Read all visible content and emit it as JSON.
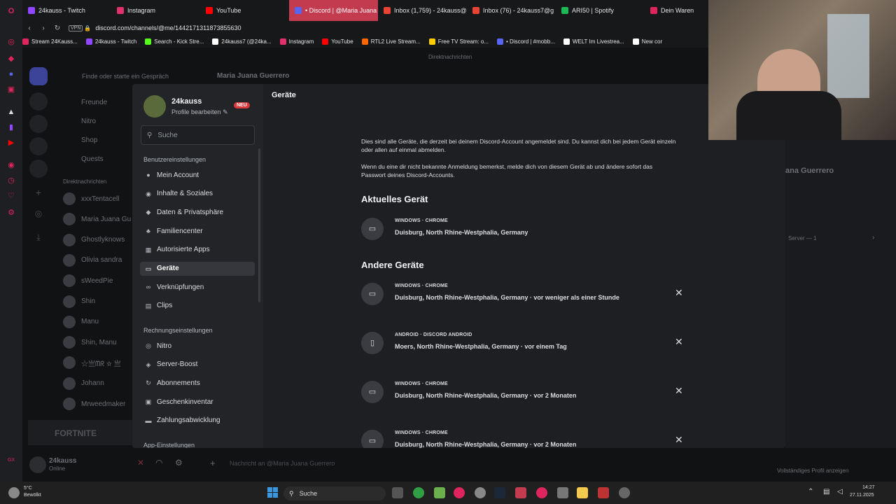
{
  "browser": {
    "tabs": [
      {
        "label": "24kauss - Twitch",
        "color": "#9146ff",
        "active": false
      },
      {
        "label": "Instagram",
        "color": "#e1306c",
        "active": false
      },
      {
        "label": "YouTube",
        "color": "#ff0000",
        "active": false
      },
      {
        "label": "• Discord | @Maria Juana",
        "color": "#5865f2",
        "active": true
      },
      {
        "label": "Inbox (1,759) - 24kauss@",
        "color": "#ea4335",
        "active": false
      },
      {
        "label": "Inbox (76) - 24kauss7@g",
        "color": "#ea4335",
        "active": false
      },
      {
        "label": "ARI50 | Spotify",
        "color": "#1db954",
        "active": false
      },
      {
        "label": "Dein Waren",
        "color": "#e0245e",
        "active": false
      }
    ],
    "vpn": "VPN",
    "url": "discord.com/channels/@me/1442171311873855630",
    "bookmarks": [
      {
        "label": "Stream 24Kauss...",
        "color": "#e0245e"
      },
      {
        "label": "24kauss - Twitch",
        "color": "#9146ff"
      },
      {
        "label": "Search - Kick Stre...",
        "color": "#53fc18"
      },
      {
        "label": "24kauss7 (@24ka...",
        "color": "#ffffff"
      },
      {
        "label": "Instagram",
        "color": "#e1306c"
      },
      {
        "label": "YouTube",
        "color": "#ff0000"
      },
      {
        "label": "RTL2 Live Stream...",
        "color": "#ff6600"
      },
      {
        "label": "Free TV Stream: o...",
        "color": "#ffcc00"
      },
      {
        "label": "• Discord | #mobb...",
        "color": "#5865f2"
      },
      {
        "label": "WELT Im Livestrea...",
        "color": "#ffffff"
      },
      {
        "label": "New cor",
        "color": "#ffffff"
      }
    ]
  },
  "discord_bg": {
    "search_placeholder": "Finde oder starte ein Gespräch",
    "dm_header": "Maria Juana Guerrero",
    "top_label": "Direktnachrichten",
    "sidebar_items": [
      "Freunde",
      "Nitro",
      "Shop",
      "Quests"
    ],
    "dm_section": "Direktnachrichten",
    "dms": [
      "xxxTentacell",
      "Maria Juana Gu",
      "Ghostlyknows",
      "Olivia sandra",
      "sWeedPie",
      "Shin",
      "Manu",
      "Shin, Manu",
      "☆亗ᗰᖇ ☆ 亗",
      "Johann",
      "Mrweedmaker"
    ],
    "user_name": "24kauss",
    "user_status": "Online",
    "message_placeholder": "Nachricht an @Maria Juana Guerrero",
    "right_name": "ana Guerrero",
    "right_server": "Server — 1",
    "right_profile": "Vollständiges Profil anzeigen",
    "game_banner": "FORTNITE"
  },
  "settings": {
    "profile_name": "24kauss",
    "profile_edit": "Profile bearbeiten",
    "new_badge": "NEU",
    "search_placeholder": "Suche",
    "section_user": "Benutzereinstellungen",
    "user_items": [
      {
        "label": "Mein Account",
        "icon": "user-icon"
      },
      {
        "label": "Inhalte & Soziales",
        "icon": "content-icon"
      },
      {
        "label": "Daten & Privatsphäre",
        "icon": "shield-icon"
      },
      {
        "label": "Familiencenter",
        "icon": "family-icon"
      },
      {
        "label": "Autorisierte Apps",
        "icon": "apps-icon"
      },
      {
        "label": "Geräte",
        "icon": "device-icon"
      },
      {
        "label": "Verknüpfungen",
        "icon": "link-icon"
      },
      {
        "label": "Clips",
        "icon": "clips-icon"
      }
    ],
    "section_billing": "Rechnungseinstellungen",
    "billing_items": [
      {
        "label": "Nitro",
        "icon": "nitro-icon"
      },
      {
        "label": "Server-Boost",
        "icon": "boost-icon"
      },
      {
        "label": "Abonnements",
        "icon": "subscriptions-icon"
      },
      {
        "label": "Geschenkinventar",
        "icon": "gift-icon"
      },
      {
        "label": "Zahlungsabwicklung",
        "icon": "payment-icon"
      }
    ],
    "section_app": "App-Einstellungen",
    "active_item": "Geräte"
  },
  "devices_page": {
    "title": "Geräte",
    "intro_1": "Dies sind alle Geräte, die derzeit bei deinem Discord-Account angemeldet sind. Du kannst dich bei jedem Gerät einzeln oder allen auf einmal abmelden.",
    "intro_2": "Wenn du eine dir nicht bekannte Anmeldung bemerkst, melde dich von diesem Gerät ab und ändere sofort das Passwort deines Discord-Accounts.",
    "current_heading": "Aktuelles Gerät",
    "current_device": {
      "type": "WINDOWS · CHROME",
      "location": "Duisburg, North Rhine-Westphalia, Germany",
      "icon": "desktop-icon"
    },
    "other_heading": "Andere Geräte",
    "other_devices": [
      {
        "type": "WINDOWS · CHROME",
        "location": "Duisburg, North Rhine-Westphalia, Germany · vor weniger als einer Stunde",
        "icon": "desktop-icon"
      },
      {
        "type": "ANDROID · DISCORD ANDROID",
        "location": "Moers, North Rhine-Westphalia, Germany · vor einem Tag",
        "icon": "mobile-icon"
      },
      {
        "type": "WINDOWS · CHROME",
        "location": "Duisburg, North Rhine-Westphalia, Germany · vor 2 Monaten",
        "icon": "desktop-icon"
      },
      {
        "type": "WINDOWS · CHROME",
        "location": "Duisburg, North Rhine-Westphalia, Germany · vor 2 Monaten",
        "icon": "desktop-icon"
      }
    ]
  },
  "taskbar": {
    "weather_temp": "5°C",
    "weather_desc": "Bewölkt",
    "search_label": "Suche",
    "time": "14:27",
    "date": "27.11.2025"
  }
}
